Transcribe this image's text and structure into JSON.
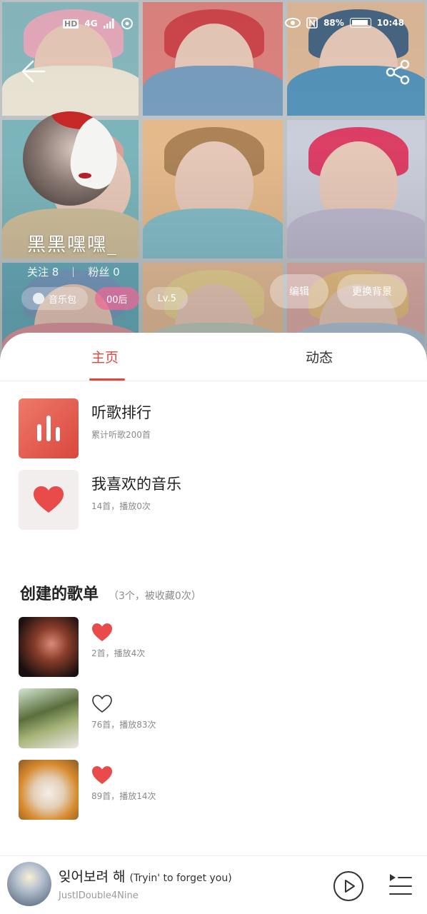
{
  "status_bar": {
    "hd": "HD",
    "network": "4G",
    "battery_pct": "88%",
    "time": "10:48"
  },
  "profile": {
    "username": "黑黑嘿嘿_",
    "follow_label": "关注 8",
    "fans_label": "粉丝 0",
    "tags": [
      "音乐包",
      "00后",
      "Lv.5"
    ],
    "edit_label": "编辑",
    "change_bg_label": "更换背景"
  },
  "tabs": {
    "home": "主页",
    "dynamic": "动态"
  },
  "top_lists": [
    {
      "title": "听歌排行",
      "sub": "累计听歌200首"
    },
    {
      "title": "我喜欢的音乐",
      "sub": "14首，播放0次"
    }
  ],
  "created": {
    "title": "创建的歌单",
    "meta": "（3个，被收藏0次）",
    "playlists": [
      {
        "sub": "2首，播放4次",
        "heart": "filled"
      },
      {
        "sub": "76首，播放83次",
        "heart": "outline"
      },
      {
        "sub": "89首，播放14次",
        "heart": "filled"
      }
    ]
  },
  "player": {
    "title_ko": "잊어보려 해",
    "title_en": "(Tryin' to forget you)",
    "artist": "JustIDouble4Nine"
  },
  "colors": {
    "accent": "#e0473e",
    "heart": "#e94b4b"
  }
}
